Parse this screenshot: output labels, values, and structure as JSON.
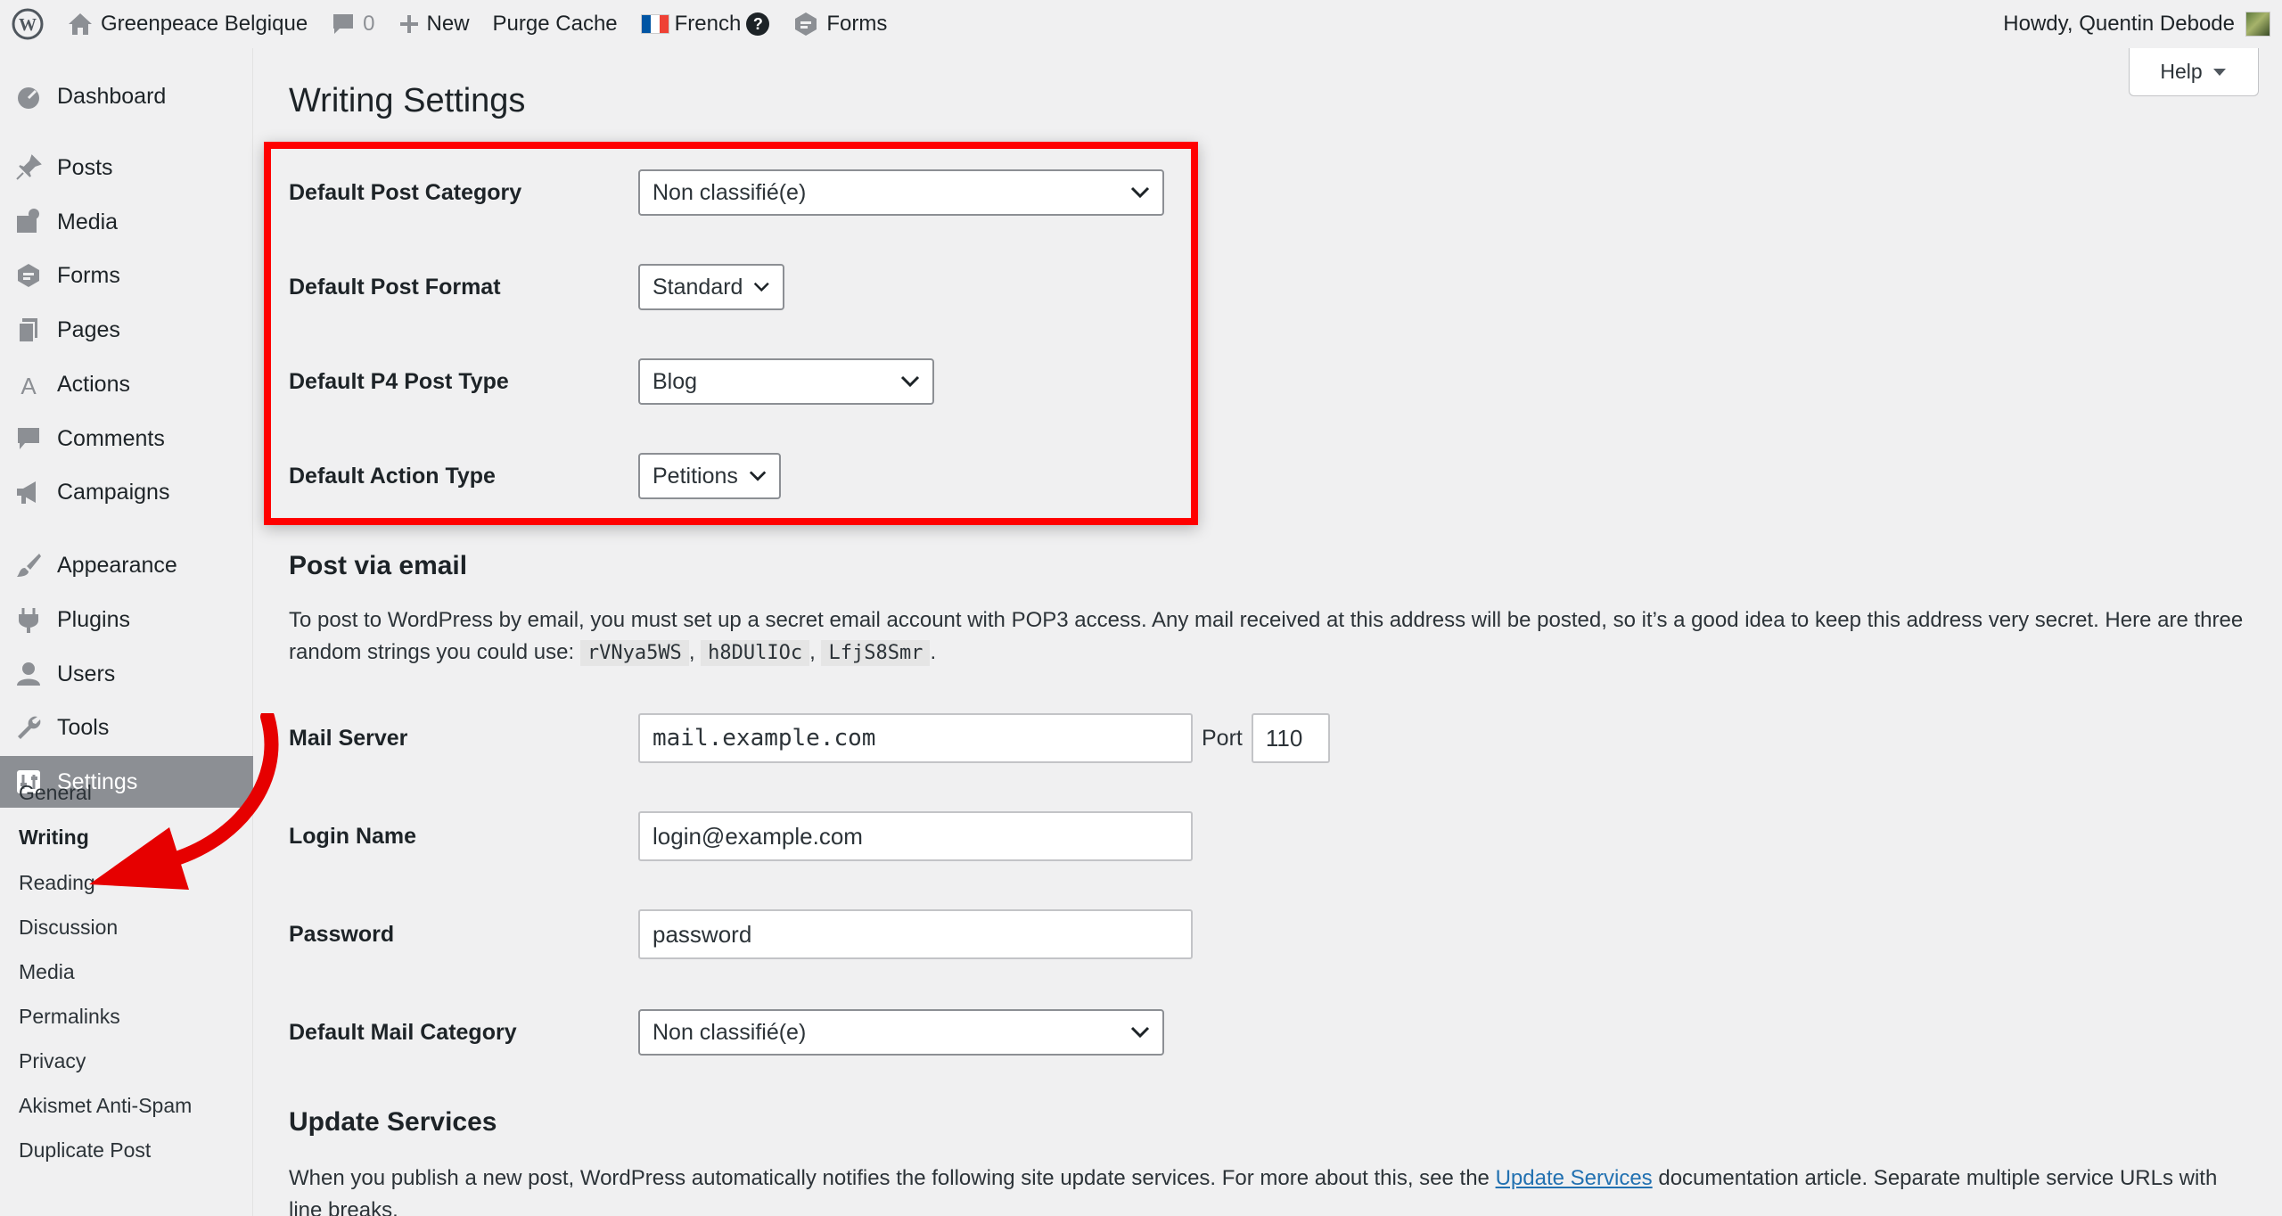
{
  "adminbar": {
    "site_name": "Greenpeace Belgique",
    "comments_count": "0",
    "new_label": "New",
    "purge_label": "Purge Cache",
    "language_label": "French",
    "language_help": "?",
    "forms_label": "Forms",
    "howdy": "Howdy, Quentin Debode"
  },
  "sidebar": {
    "items": [
      {
        "label": "Dashboard",
        "icon": "dashboard-icon"
      },
      {
        "label": "Posts",
        "icon": "pin-icon"
      },
      {
        "label": "Media",
        "icon": "media-icon"
      },
      {
        "label": "Forms",
        "icon": "forms-icon"
      },
      {
        "label": "Pages",
        "icon": "pages-icon"
      },
      {
        "label": "Actions",
        "icon": "actions-icon"
      },
      {
        "label": "Comments",
        "icon": "comments-icon"
      },
      {
        "label": "Campaigns",
        "icon": "megaphone-icon"
      },
      {
        "label": "Appearance",
        "icon": "brush-icon"
      },
      {
        "label": "Plugins",
        "icon": "plugin-icon"
      },
      {
        "label": "Users",
        "icon": "users-icon"
      },
      {
        "label": "Tools",
        "icon": "wrench-icon"
      },
      {
        "label": "Settings",
        "icon": "settings-icon"
      }
    ],
    "submenu": [
      "General",
      "Writing",
      "Reading",
      "Discussion",
      "Media",
      "Permalinks",
      "Privacy",
      "Akismet Anti-Spam",
      "Duplicate Post"
    ]
  },
  "page": {
    "title": "Writing Settings",
    "help_label": "Help"
  },
  "defaults": {
    "category_label": "Default Post Category",
    "category_value": "Non classifié(e)",
    "format_label": "Default Post Format",
    "format_value": "Standard",
    "p4_type_label": "Default P4 Post Type",
    "p4_type_value": "Blog",
    "action_type_label": "Default Action Type",
    "action_type_value": "Petitions"
  },
  "post_via_email": {
    "title": "Post via email",
    "desc_1": "To post to WordPress by email, you must set up a secret email account with POP3 access. Any mail received at this address will be posted, so it’s a good idea to keep this address very secret. Here are three random strings you could use:",
    "random_1": "rVNya5WS",
    "random_2": "h8DUlIOc",
    "random_3": "LfjS8Smr",
    "mail_server_label": "Mail Server",
    "mail_server_value": "mail.example.com",
    "port_label": "Port",
    "port_value": "110",
    "login_label": "Login Name",
    "login_value": "login@example.com",
    "password_label": "Password",
    "password_value": "password",
    "mail_category_label": "Default Mail Category",
    "mail_category_value": "Non classifié(e)"
  },
  "update_services": {
    "title": "Update Services",
    "desc_before": "When you publish a new post, WordPress automatically notifies the following site update services. For more about this, see the",
    "link_text": "Update Services",
    "desc_after": "documentation article. Separate multiple service URLs with line breaks."
  },
  "colors": {
    "highlight": "#ff0000",
    "link": "#2271b1",
    "active_menu": "#8c8f94"
  }
}
